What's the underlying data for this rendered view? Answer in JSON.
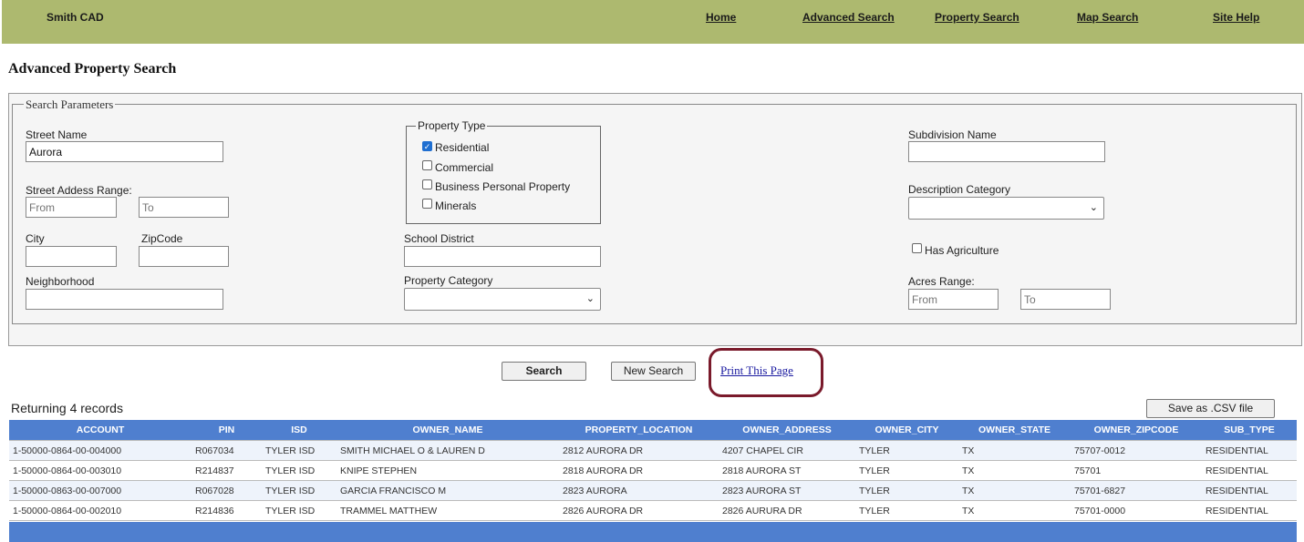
{
  "header": {
    "brand": "Smith CAD",
    "nav": [
      "Home",
      "Advanced Search",
      "Property Search",
      "Map Search",
      "Site Help"
    ]
  },
  "page_title": "Advanced Property Search",
  "form": {
    "legend": "Search Parameters",
    "street_name": {
      "label": "Street Name",
      "value": "Aurora"
    },
    "street_range": {
      "label": "Street Addess Range:",
      "from": "From",
      "to": "To"
    },
    "city": {
      "label": "City",
      "value": ""
    },
    "zipcode": {
      "label": "ZipCode",
      "value": ""
    },
    "neighborhood": {
      "label": "Neighborhood",
      "value": ""
    },
    "property_type": {
      "legend": "Property Type",
      "options": [
        {
          "label": "Residential",
          "checked": true
        },
        {
          "label": "Commercial",
          "checked": false
        },
        {
          "label": "Business Personal Property",
          "checked": false
        },
        {
          "label": "Minerals",
          "checked": false
        }
      ]
    },
    "school_district": {
      "label": "School District",
      "value": ""
    },
    "property_category": {
      "label": "Property Category",
      "value": ""
    },
    "subdivision": {
      "label": "Subdivision Name",
      "value": ""
    },
    "description_category": {
      "label": "Description Category",
      "value": ""
    },
    "has_agriculture": {
      "label": "Has Agriculture",
      "checked": false
    },
    "acres_range": {
      "label": "Acres Range:",
      "from": "From",
      "to": "To"
    }
  },
  "actions": {
    "search": "Search",
    "new_search": "New Search",
    "print": "Print This Page",
    "save_csv": "Save as .CSV file"
  },
  "results": {
    "summary": "Returning 4 records",
    "columns": [
      "ACCOUNT",
      "PIN",
      "ISD",
      "OWNER_NAME",
      "PROPERTY_LOCATION",
      "OWNER_ADDRESS",
      "OWNER_CITY",
      "OWNER_STATE",
      "OWNER_ZIPCODE",
      "SUB_TYPE"
    ],
    "rows": [
      [
        "1-50000-0864-00-004000",
        "R067034",
        "TYLER ISD",
        "SMITH MICHAEL O & LAUREN D",
        "2812 AURORA DR",
        "4207 CHAPEL CIR",
        "TYLER",
        "TX",
        "75707-0012",
        "RESIDENTIAL"
      ],
      [
        "1-50000-0864-00-003010",
        "R214837",
        "TYLER ISD",
        "KNIPE STEPHEN",
        "2818 AURORA DR",
        "2818 AURORA ST",
        "TYLER",
        "TX",
        "75701",
        "RESIDENTIAL"
      ],
      [
        "1-50000-0863-00-007000",
        "R067028",
        "TYLER ISD",
        "GARCIA FRANCISCO M",
        "2823 AURORA",
        "2823 AURORA ST",
        "TYLER",
        "TX",
        "75701-6827",
        "RESIDENTIAL"
      ],
      [
        "1-50000-0864-00-002010",
        "R214836",
        "TYLER ISD",
        "TRAMMEL MATTHEW",
        "2826 AURORA DR",
        "2826 AURURA DR",
        "TYLER",
        "TX",
        "75701-0000",
        "RESIDENTIAL"
      ]
    ]
  },
  "colors": {
    "header_bg": "#adb96f",
    "table_header": "#4f7fcf",
    "highlight_ring": "#7a1a2b"
  }
}
